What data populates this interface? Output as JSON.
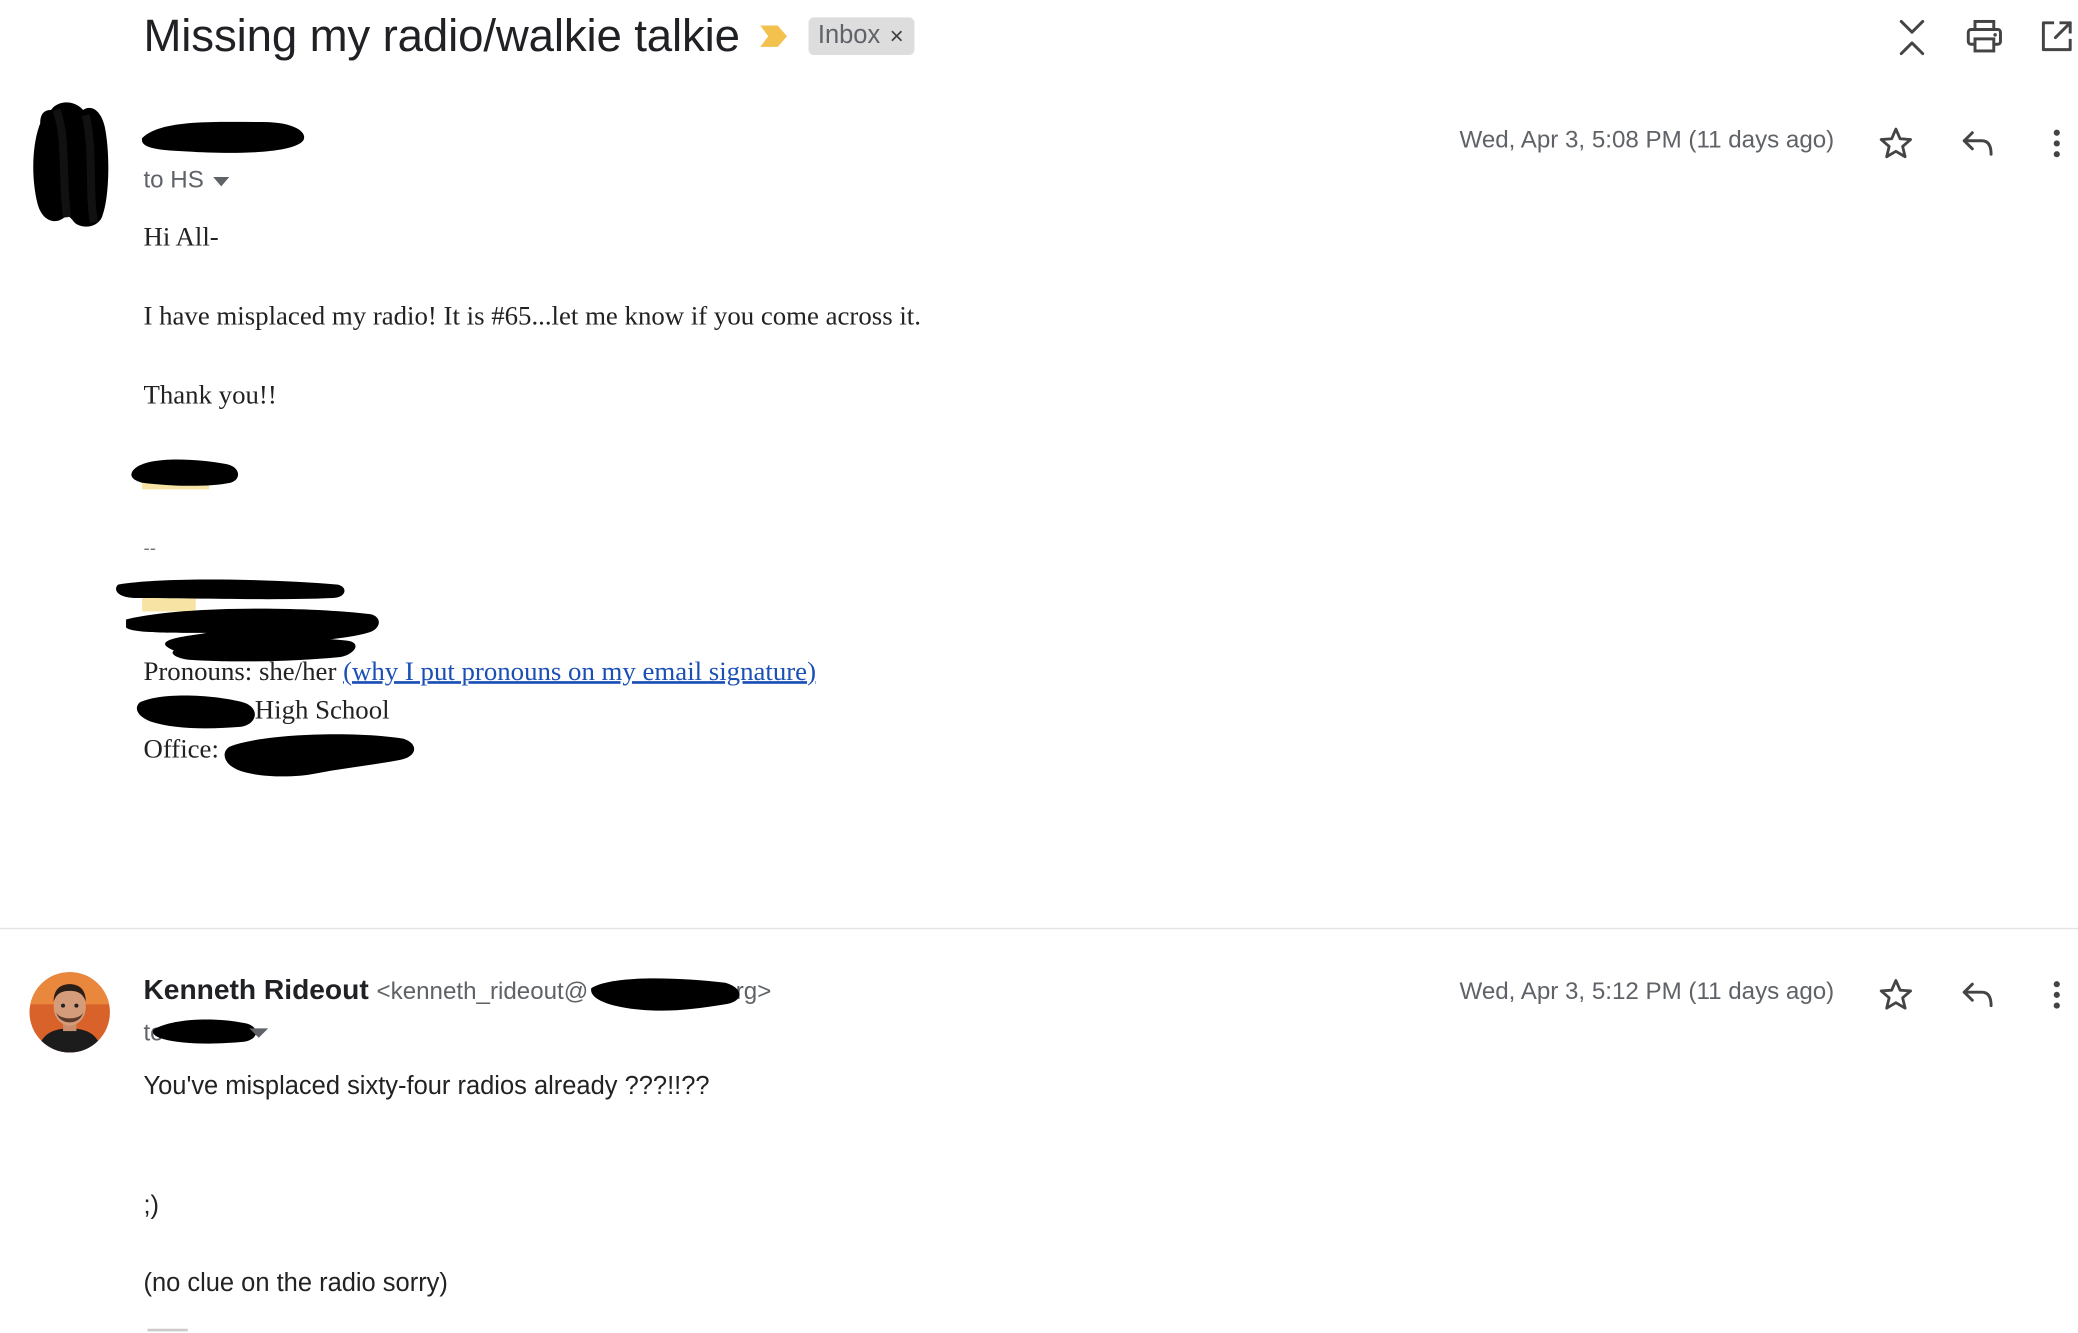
{
  "thread": {
    "subject": "Missing my radio/walkie talkie",
    "label": "Inbox",
    "label_remove": "×"
  },
  "toolbar": {
    "icons": [
      "collapse-all-icon",
      "print-icon",
      "open-in-new-window-icon"
    ]
  },
  "messages": [
    {
      "to_label": "to HS",
      "date": "Wed, Apr 3, 5:08 PM (11 days ago)",
      "body": {
        "greeting": "Hi All-",
        "line1": "I have misplaced my radio! It is #65...let me know if you come across it.",
        "closing": "Thank you!!",
        "sig_dash": "--",
        "pronouns": "Pronouns: she/her",
        "pronouns_link": "(why I put pronouns on my email signature)",
        "school": "High School",
        "office": "Office:"
      }
    },
    {
      "sender_name": "Kenneth Rideout",
      "sender_email_start": "<kenneth_rideout@",
      "sender_email_end": "rg>",
      "to_label": "to",
      "date": "Wed, Apr 3, 5:12 PM (11 days ago)",
      "body": {
        "line1": "You've misplaced sixty-four radios already ???!!??",
        "line2": ";)",
        "line3": "(no clue on the radio sorry)"
      }
    }
  ],
  "colors": {
    "importance_marker": "#f2c14e",
    "link": "#1a4fb5",
    "label_chip_bg": "#dddddd",
    "muted_text": "#5f6368",
    "redaction": "#000000"
  }
}
